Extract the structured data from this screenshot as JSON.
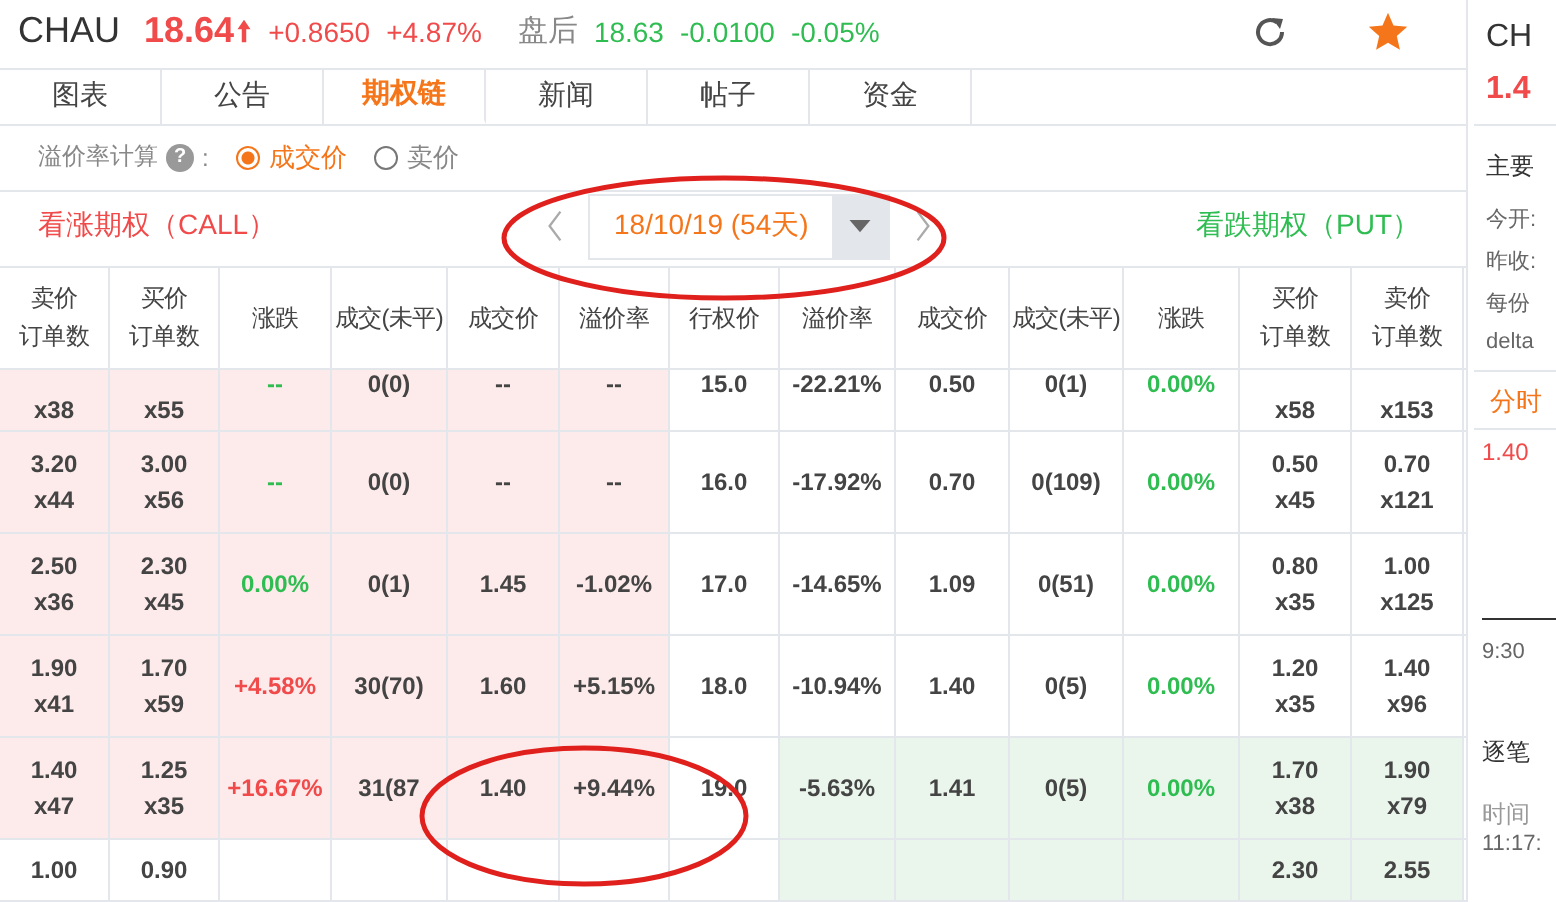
{
  "quote": {
    "symbol": "CHAU",
    "price": "18.64",
    "change": "+0.8650",
    "change_pct": "+4.87%",
    "after_label": "盘后",
    "after_price": "18.63",
    "after_change": "-0.0100",
    "after_change_pct": "-0.05%"
  },
  "tabs": [
    {
      "label": "图表",
      "selected": false
    },
    {
      "label": "公告",
      "selected": false
    },
    {
      "label": "期权链",
      "selected": true
    },
    {
      "label": "新闻",
      "selected": false
    },
    {
      "label": "帖子",
      "selected": false
    },
    {
      "label": "资金",
      "selected": false
    }
  ],
  "premium_calc": {
    "label": "溢价率计算",
    "help": "?",
    "colon": ":",
    "options": [
      {
        "label": "成交价",
        "selected": true
      },
      {
        "label": "卖价",
        "selected": false
      }
    ]
  },
  "expiry": {
    "call_label": "看涨期权（CALL）",
    "date": "18/10/19 (54天)",
    "put_label": "看跌期权（PUT）"
  },
  "table": {
    "columns": [
      [
        "卖价",
        "订单数"
      ],
      [
        "买价",
        "订单数"
      ],
      [
        "涨跌"
      ],
      [
        "成交(未平)"
      ],
      [
        "成交价"
      ],
      [
        "溢价率"
      ],
      [
        "行权价"
      ],
      [
        "溢价率"
      ],
      [
        "成交价"
      ],
      [
        "成交(未平)"
      ],
      [
        "涨跌"
      ],
      [
        "买价",
        "订单数"
      ],
      [
        "卖价",
        "订单数"
      ]
    ],
    "rows": [
      {
        "call_itm": true,
        "put_itm": false,
        "call_ask_size": "x38",
        "call_bid_size": "x55",
        "call_change": {
          "text": "--",
          "color": "#2fbd52"
        },
        "call_vol": "0(0)",
        "call_last": "--",
        "call_premium": "--",
        "strike": "15.0",
        "put_premium": "-22.21%",
        "put_last": "0.50",
        "put_vol": "0(1)",
        "put_change": {
          "text": "0.00%",
          "color": "#2fbd52"
        },
        "put_bid_size": "x58",
        "put_ask_size": "x153"
      },
      {
        "call_itm": true,
        "put_itm": false,
        "call_ask": "3.20",
        "call_ask_size": "x44",
        "call_bid": "3.00",
        "call_bid_size": "x56",
        "call_change": {
          "text": "--",
          "color": "#2fbd52"
        },
        "call_vol": "0(0)",
        "call_last": "--",
        "call_premium": "--",
        "strike": "16.0",
        "put_premium": "-17.92%",
        "put_last": "0.70",
        "put_vol": "0(109)",
        "put_change": {
          "text": "0.00%",
          "color": "#2fbd52"
        },
        "put_bid": "0.50",
        "put_bid_size": "x45",
        "put_ask": "0.70",
        "put_ask_size": "x121"
      },
      {
        "call_itm": true,
        "put_itm": false,
        "call_ask": "2.50",
        "call_ask_size": "x36",
        "call_bid": "2.30",
        "call_bid_size": "x45",
        "call_change": {
          "text": "0.00%",
          "color": "#2fbd52"
        },
        "call_vol": "0(1)",
        "call_last": "1.45",
        "call_premium": "-1.02%",
        "strike": "17.0",
        "put_premium": "-14.65%",
        "put_last": "1.09",
        "put_vol": "0(51)",
        "put_change": {
          "text": "0.00%",
          "color": "#2fbd52"
        },
        "put_bid": "0.80",
        "put_bid_size": "x35",
        "put_ask": "1.00",
        "put_ask_size": "x125"
      },
      {
        "call_itm": true,
        "put_itm": false,
        "call_ask": "1.90",
        "call_ask_size": "x41",
        "call_bid": "1.70",
        "call_bid_size": "x59",
        "call_change": {
          "text": "+4.58%",
          "color": "#f04a4a"
        },
        "call_vol": "30(70)",
        "call_last": "1.60",
        "call_premium": "+5.15%",
        "strike": "18.0",
        "put_premium": "-10.94%",
        "put_last": "1.40",
        "put_vol": "0(5)",
        "put_change": {
          "text": "0.00%",
          "color": "#2fbd52"
        },
        "put_bid": "1.20",
        "put_bid_size": "x35",
        "put_ask": "1.40",
        "put_ask_size": "x96"
      },
      {
        "call_itm": true,
        "put_itm": true,
        "call_ask": "1.40",
        "call_ask_size": "x47",
        "call_bid": "1.25",
        "call_bid_size": "x35",
        "call_change": {
          "text": "+16.67%",
          "color": "#f04a4a"
        },
        "call_vol": "31(87",
        "call_last": "1.40",
        "call_premium": "+9.44%",
        "strike": "19.0",
        "put_premium": "-5.63%",
        "put_last": "1.41",
        "put_vol": "0(5)",
        "put_change": {
          "text": "0.00%",
          "color": "#2fbd52"
        },
        "put_bid": "1.70",
        "put_bid_size": "x38",
        "put_ask": "1.90",
        "put_ask_size": "x79"
      },
      {
        "call_itm": false,
        "put_itm": true,
        "call_ask": "1.00",
        "call_bid": "0.90",
        "put_bid": "2.30",
        "put_ask": "2.55"
      }
    ]
  },
  "sidebar": {
    "symbol": "CH",
    "price": "1.4",
    "section": "主要",
    "stats": [
      "今开:",
      "昨收:",
      "每份",
      "delta"
    ],
    "chart_tab": "分时",
    "chart_price": "1.40",
    "chart_time": "9:30",
    "trades_title": "逐笔",
    "time_header": "时间",
    "trade_time": "11:17:"
  }
}
